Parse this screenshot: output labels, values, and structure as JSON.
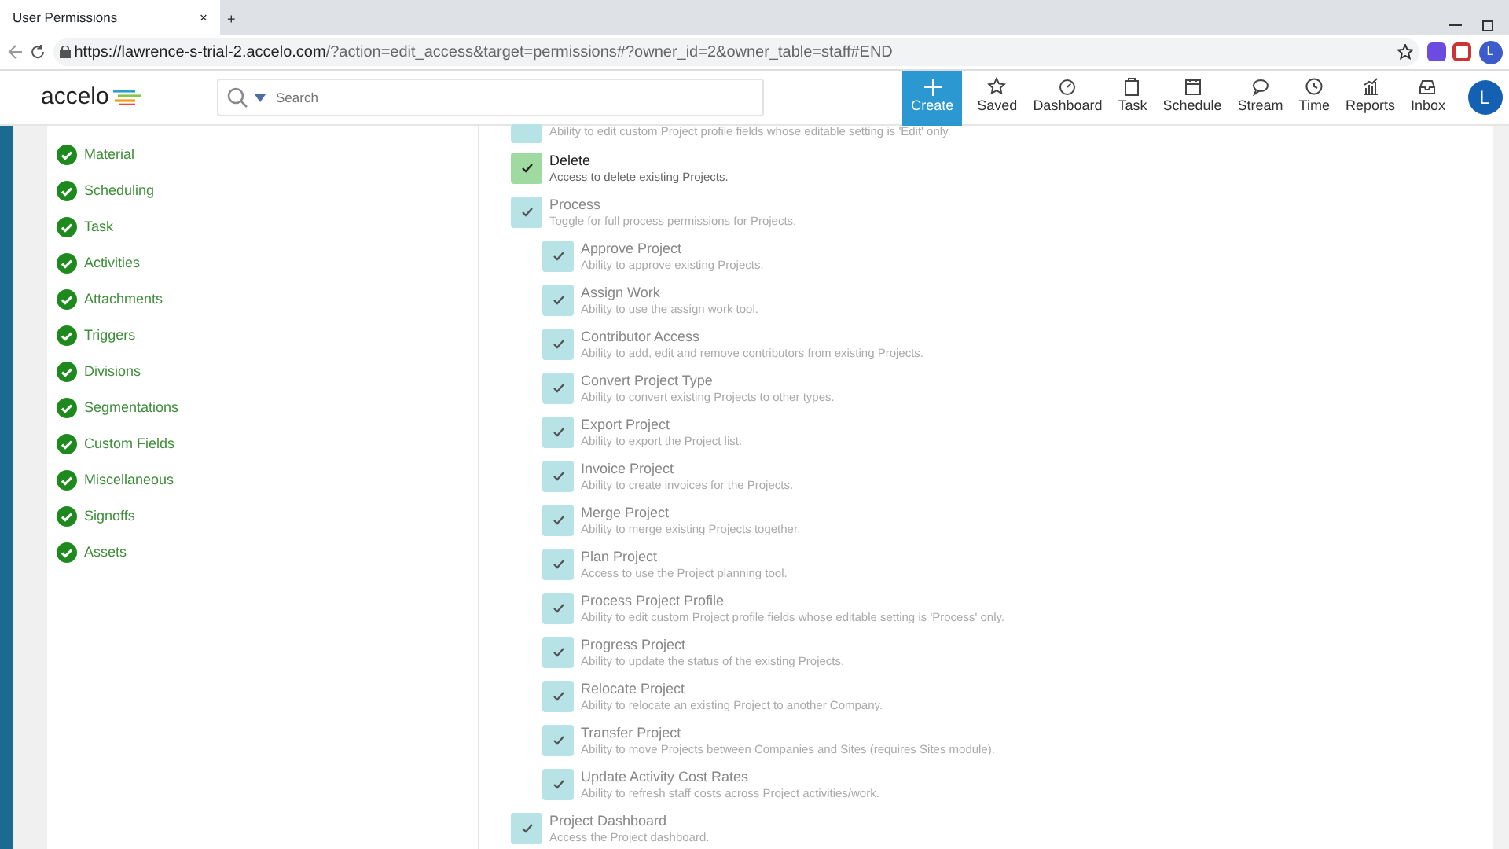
{
  "browser": {
    "tab_title": "User Permissions",
    "tab_close": "×",
    "new_tab": "+",
    "url_host": "https://lawrence-s-trial-2.accelo.com",
    "url_path": "/?action=edit_access&target=permissions#?owner_id=2&owner_table=staff#END",
    "profile_initial": "L"
  },
  "app": {
    "logo": "accelo",
    "search_placeholder": "Search",
    "create_label": "Create",
    "nav": [
      {
        "label": "Saved"
      },
      {
        "label": "Dashboard"
      },
      {
        "label": "Task"
      },
      {
        "label": "Schedule"
      },
      {
        "label": "Stream"
      },
      {
        "label": "Time"
      },
      {
        "label": "Reports"
      },
      {
        "label": "Inbox"
      }
    ],
    "avatar_initial": "L"
  },
  "sidebar": {
    "items": [
      {
        "label": "Material",
        "complete": true
      },
      {
        "label": "Scheduling",
        "complete": true
      },
      {
        "label": "Task",
        "complete": true
      },
      {
        "label": "Activities",
        "complete": true
      },
      {
        "label": "Attachments",
        "complete": true
      },
      {
        "label": "Triggers",
        "complete": true
      },
      {
        "label": "Divisions",
        "complete": true
      },
      {
        "label": "Segmentations",
        "complete": true
      },
      {
        "label": "Custom Fields",
        "complete": true
      },
      {
        "label": "Miscellaneous",
        "complete": true
      },
      {
        "label": "Signoffs",
        "complete": true
      },
      {
        "label": "Assets",
        "complete": true
      }
    ]
  },
  "permissions": [
    {
      "description": "Ability to edit custom Project profile fields whose editable setting is 'Edit' only.",
      "checked": true,
      "disabled": true
    },
    {
      "title": "Delete",
      "description": "Access to delete existing Projects.",
      "checked": true,
      "disabled": false
    },
    {
      "title": "Process",
      "description": "Toggle for full process permissions for Projects.",
      "checked": true,
      "disabled": true,
      "children": [
        {
          "title": "Approve Project",
          "description": "Ability to approve existing Projects.",
          "checked": true,
          "disabled": true
        },
        {
          "title": "Assign Work",
          "description": "Ability to use the assign work tool.",
          "checked": true,
          "disabled": true
        },
        {
          "title": "Contributor Access",
          "description": "Ability to add, edit and remove contributors from existing Projects.",
          "checked": true,
          "disabled": true
        },
        {
          "title": "Convert Project Type",
          "description": "Ability to convert existing Projects to other types.",
          "checked": true,
          "disabled": true
        },
        {
          "title": "Export Project",
          "description": "Ability to export the Project list.",
          "checked": true,
          "disabled": true
        },
        {
          "title": "Invoice Project",
          "description": "Ability to create invoices for the Projects.",
          "checked": true,
          "disabled": true
        },
        {
          "title": "Merge Project",
          "description": "Ability to merge existing Projects together.",
          "checked": true,
          "disabled": true
        },
        {
          "title": "Plan Project",
          "description": "Access to use the Project planning tool.",
          "checked": true,
          "disabled": true
        },
        {
          "title": "Process Project Profile",
          "description": "Ability to edit custom Project profile fields whose editable setting is 'Process' only.",
          "checked": true,
          "disabled": true
        },
        {
          "title": "Progress Project",
          "description": "Ability to update the status of the existing Projects.",
          "checked": true,
          "disabled": true
        },
        {
          "title": "Relocate Project",
          "description": "Ability to relocate an existing Project to another Company.",
          "checked": true,
          "disabled": true
        },
        {
          "title": "Transfer Project",
          "description": "Ability to move Projects between Companies and Sites (requires Sites module).",
          "checked": true,
          "disabled": true
        },
        {
          "title": "Update Activity Cost Rates",
          "description": "Ability to refresh staff costs across Project activities/work.",
          "checked": true,
          "disabled": true
        }
      ]
    },
    {
      "title": "Project Dashboard",
      "description": "Access the Project dashboard.",
      "checked": true,
      "disabled": true
    }
  ]
}
